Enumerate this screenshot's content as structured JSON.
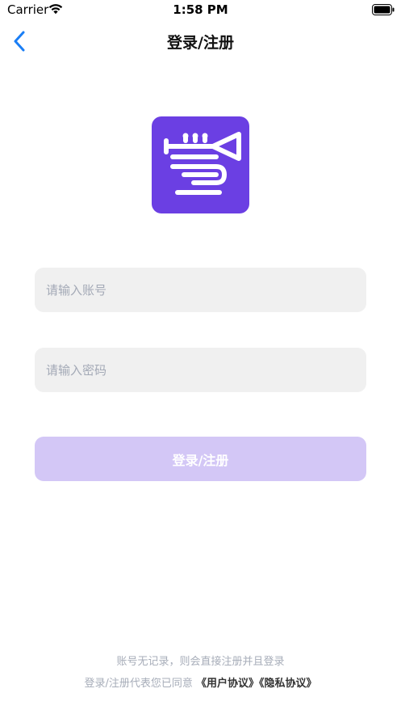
{
  "status_bar": {
    "carrier": "Carrier",
    "time": "1:58 PM"
  },
  "nav": {
    "title": "登录/注册",
    "back_icon": "chevron-left-icon"
  },
  "logo": {
    "icon": "trumpet-logo-icon",
    "bg_color": "#6b3fe3"
  },
  "form": {
    "account_placeholder": "请输入账号",
    "account_value": "",
    "password_placeholder": "请输入密码",
    "password_value": "",
    "submit_label": "登录/注册"
  },
  "footer": {
    "note": "账号无记录，则会直接注册并且登录",
    "agree_prefix": "登录/注册代表您已同意",
    "user_agreement": "《用户协议》",
    "privacy_policy": "《隐私协议》"
  },
  "colors": {
    "accent": "#1a7ef5",
    "brand": "#6b3fe3",
    "button_disabled": "#d3c7f6",
    "input_bg": "#f0f0f0",
    "hint_text": "#a7adb9"
  }
}
